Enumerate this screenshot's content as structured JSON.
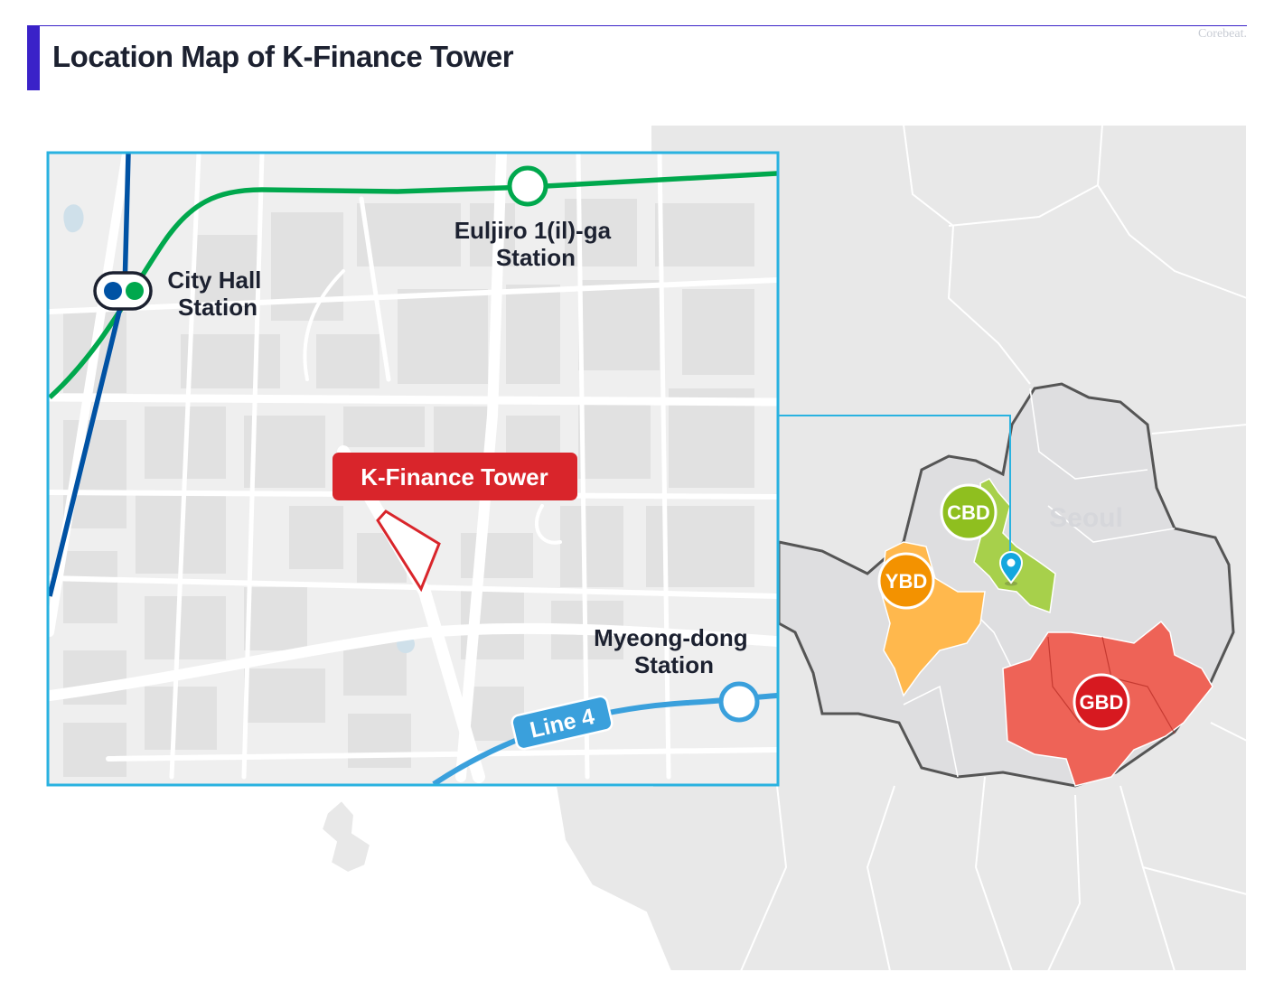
{
  "header": {
    "title": "Location Map of K-Finance Tower",
    "credit": "Corebeat."
  },
  "inset_map": {
    "target": {
      "label": "K-Finance Tower"
    },
    "stations": [
      {
        "name": "euljiro-station",
        "lines": [
          "Euljiro 1(il)-ga",
          "Station"
        ]
      },
      {
        "name": "city-hall-station",
        "lines": [
          "City Hall",
          "Station"
        ]
      },
      {
        "name": "myeongdong-station",
        "lines": [
          "Myeong-dong",
          "Station"
        ]
      }
    ],
    "line_badge": "Line 4"
  },
  "overview_map": {
    "city_label": "Seoul",
    "districts": [
      {
        "name": "cbd",
        "label": "CBD",
        "color": "#8fbf1f"
      },
      {
        "name": "ybd",
        "label": "YBD",
        "color": "#f39200"
      },
      {
        "name": "gbd",
        "label": "GBD",
        "color": "#d71920"
      }
    ]
  },
  "colors": {
    "accent": "#3a22c8",
    "inset_border": "#29b2e0",
    "line_green": "#00a84d",
    "line_blue_dark": "#0052a4",
    "line_blue_light": "#3aa0dc",
    "target_red": "#d9252b"
  }
}
